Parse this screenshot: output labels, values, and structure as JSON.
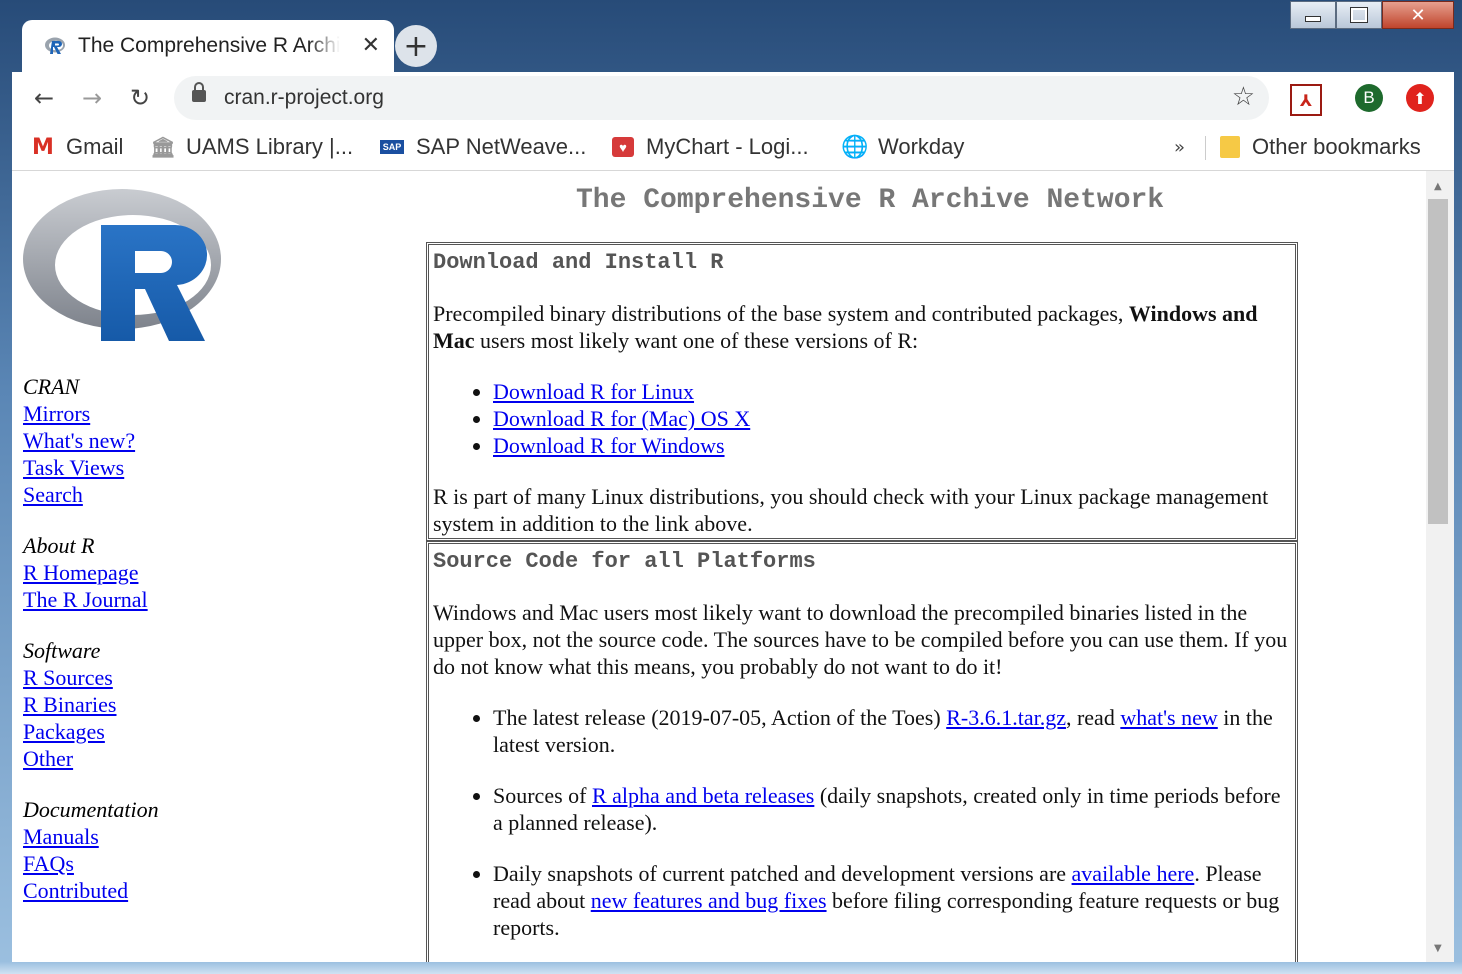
{
  "window": {
    "minimize_icon": "minimize-icon",
    "maximize_icon": "maximize-icon",
    "close_glyph": "✕"
  },
  "tab": {
    "title": "The Comprehensive R Archive Network",
    "close_glyph": "✕"
  },
  "newtab_glyph": "+",
  "toolbar": {
    "back_glyph": "←",
    "forward_glyph": "→",
    "reload_glyph": "↻",
    "url": "cran.r-project.org",
    "star_glyph": "☆",
    "avatar_letter": "B",
    "update_glyph": "⬆"
  },
  "bookmarks": {
    "items": [
      {
        "label": "Gmail",
        "icon": "gmail-icon",
        "glyph": "M"
      },
      {
        "label": "UAMS Library |...",
        "icon": "library-icon",
        "glyph": "🏛"
      },
      {
        "label": "SAP NetWeave...",
        "icon": "sap-icon",
        "glyph": "SAP"
      },
      {
        "label": "MyChart - Logi...",
        "icon": "mychart-icon",
        "glyph": "♥"
      },
      {
        "label": "Workday",
        "icon": "globe-icon",
        "glyph": "🌐"
      }
    ],
    "overflow_glyph": "»",
    "other_label": "Other bookmarks"
  },
  "page": {
    "title": "The Comprehensive R Archive Network",
    "nav": {
      "cran_head": "CRAN",
      "cran_links": [
        "Mirrors",
        "What's new?",
        "Task Views",
        "Search"
      ],
      "about_head": "About R",
      "about_links": [
        "R Homepage",
        "The R Journal"
      ],
      "software_head": "Software",
      "software_links": [
        "R Sources",
        "R Binaries",
        "Packages",
        "Other"
      ],
      "doc_head": "Documentation",
      "doc_links": [
        "Manuals",
        "FAQs",
        "Contributed"
      ]
    },
    "download_box": {
      "heading": "Download and Install R",
      "intro_before": "Precompiled binary distributions of the base system and contributed packages, ",
      "intro_bold": "Windows and Mac",
      "intro_after": " users most likely want one of these versions of R:",
      "links": [
        "Download R for Linux",
        "Download R for (Mac) OS X",
        "Download R for Windows"
      ],
      "note": "R is part of many Linux distributions, you should check with your Linux package management system in addition to the link above."
    },
    "source_box": {
      "heading": "Source Code for all Platforms",
      "intro": "Windows and Mac users most likely want to download the precompiled binaries listed in the upper box, not the source code. The sources have to be compiled before you can use them. If you do not know what this means, you probably do not want to do it!",
      "item1_before": "The latest release (2019-07-05, Action of the Toes) ",
      "item1_link1": "R-3.6.1.tar.gz",
      "item1_mid": ", read ",
      "item1_link2": "what's new",
      "item1_after": " in the latest version.",
      "item2_before": "Sources of ",
      "item2_link": "R alpha and beta releases",
      "item2_after": " (daily snapshots, created only in time periods before a planned release).",
      "item3_before": "Daily snapshots of current patched and development versions are ",
      "item3_link1": "available here",
      "item3_mid": ". Please read about ",
      "item3_link2": "new features and bug fixes",
      "item3_after": " before filing corresponding feature requests or bug reports."
    }
  },
  "colors": {
    "link": "#0000ee",
    "title_gray": "#777777",
    "r_logo_blue": "#1f65b7"
  }
}
